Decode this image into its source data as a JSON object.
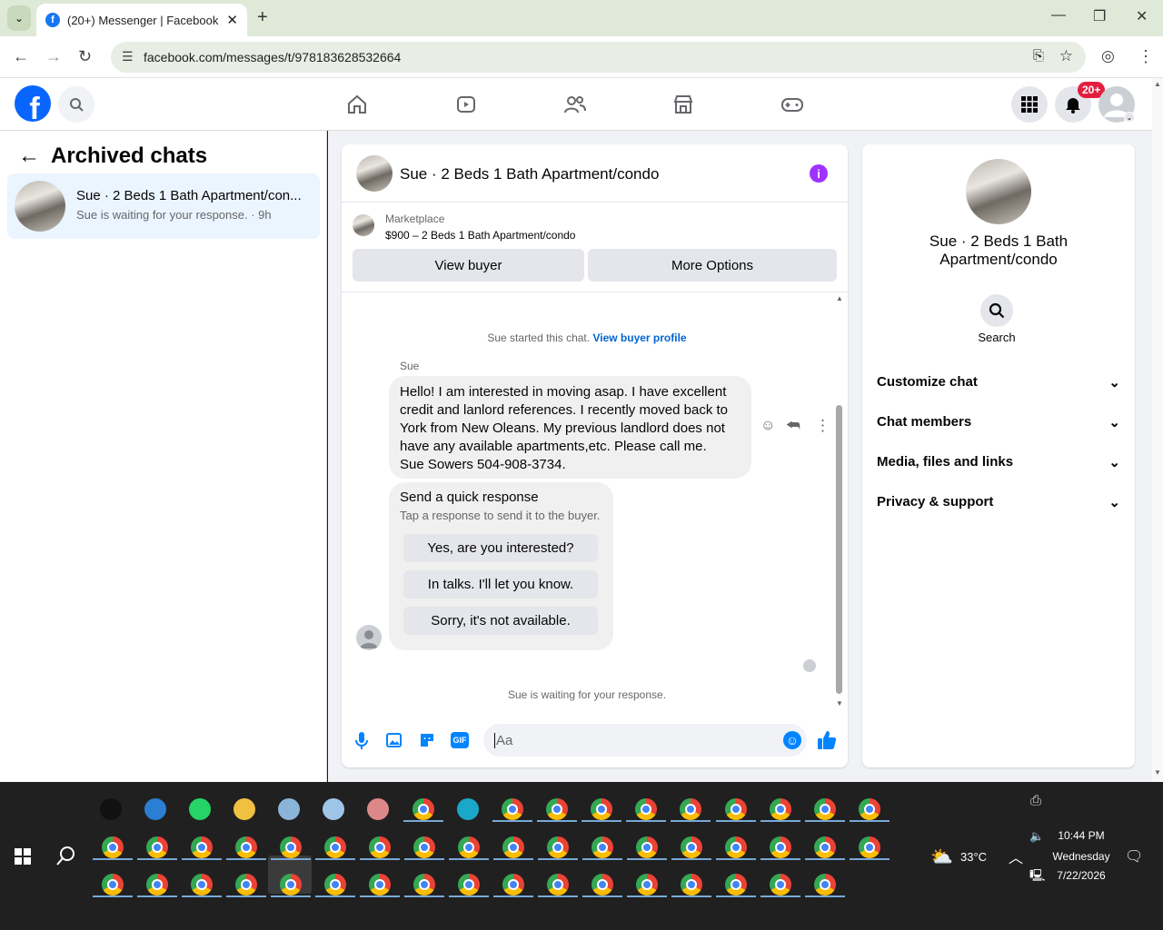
{
  "browser": {
    "tab_title": "(20+) Messenger | Facebook",
    "url": "facebook.com/messages/t/978183628532664"
  },
  "fb": {
    "notif_count": "20+"
  },
  "left": {
    "title": "Archived chats",
    "chat": {
      "name": "Sue · 2 Beds 1 Bath Apartment/con...",
      "preview": "Sue is waiting for your response. · 9h"
    }
  },
  "conversation": {
    "title": "Sue · 2 Beds 1 Bath Apartment/condo",
    "marketplace_label": "Marketplace",
    "listing": "$900 – 2 Beds 1 Bath Apartment/condo",
    "view_buyer": "View buyer",
    "more_options": "More Options",
    "started_text": "Sue started this chat.",
    "view_buyer_profile": "View buyer profile",
    "sender": "Sue",
    "message_lines": [
      "Hello! I am interested in moving asap.  I have excellent",
      "credit and lanlord references. I recently moved back to",
      "York from New Oleans.  My previous landlord does not",
      "have any available apartments,etc. Please call me.",
      "Sue Sowers 504-908-3734."
    ],
    "quick_title": "Send a quick response",
    "quick_sub": "Tap a response to send it to the buyer.",
    "quick_options": [
      "Yes, are you interested?",
      "In talks. I'll let you know.",
      "Sorry, it's not available."
    ],
    "waiting": "Sue is waiting for your response.",
    "input_placeholder": "Aa"
  },
  "right": {
    "name_line1": "Sue · 2 Beds 1 Bath",
    "name_line2": "Apartment/condo",
    "search": "Search",
    "sections": [
      "Customize chat",
      "Chat members",
      "Media, files and links",
      "Privacy & support"
    ]
  },
  "taskbar": {
    "weather": "33°C",
    "time": "10:44 PM",
    "day": "Wednesday",
    "date": "7/22/2026"
  },
  "colors": {
    "fb_blue": "#0866ff",
    "messenger_accent": "#0084ff",
    "info_purple": "#a033ff",
    "badge_red": "#e41e3f"
  }
}
